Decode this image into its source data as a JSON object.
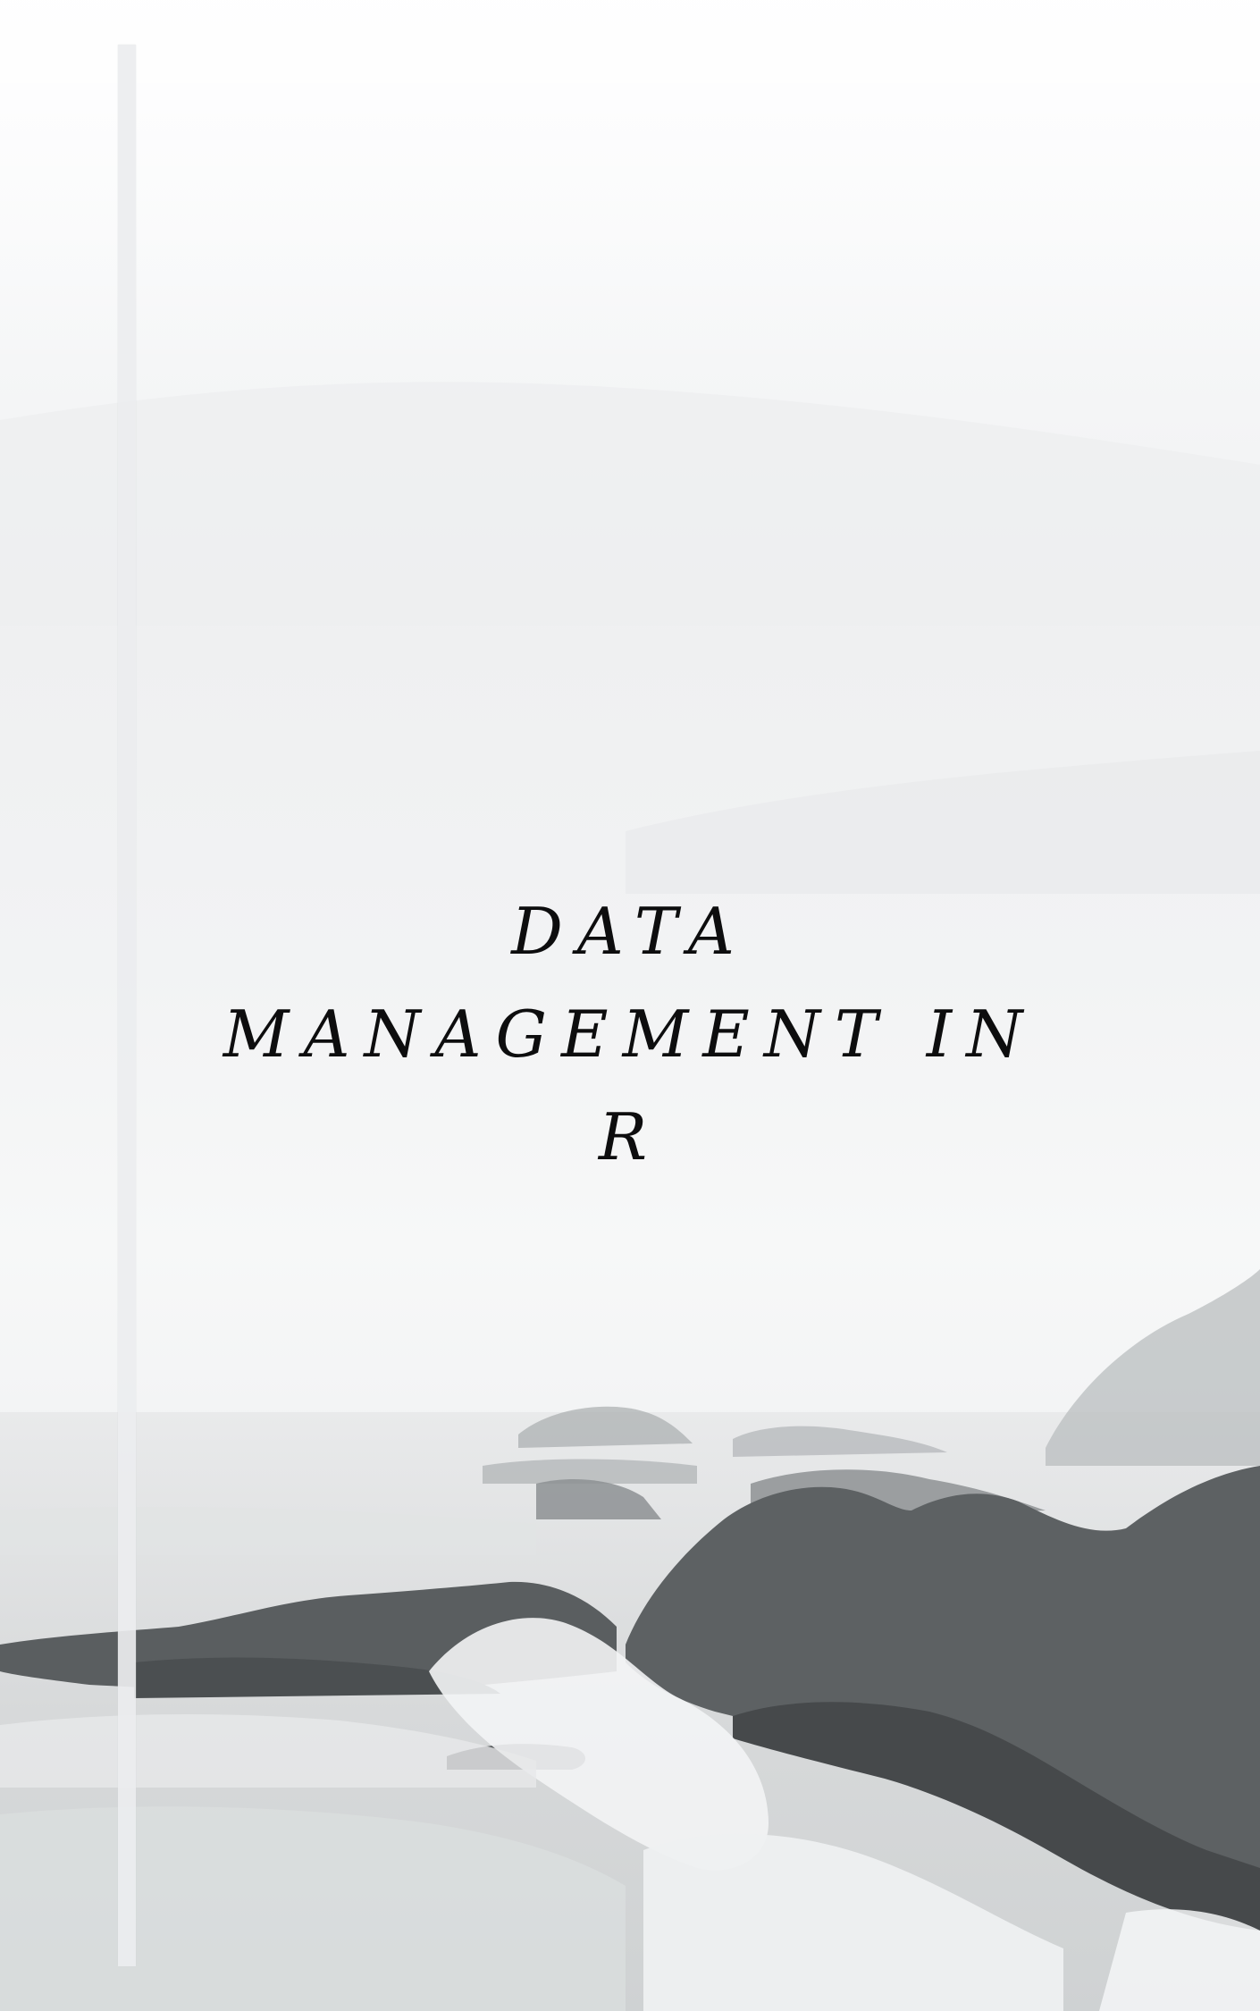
{
  "cover": {
    "title_lines": [
      "DATA",
      "MANAGEMENT IN",
      "R"
    ]
  }
}
